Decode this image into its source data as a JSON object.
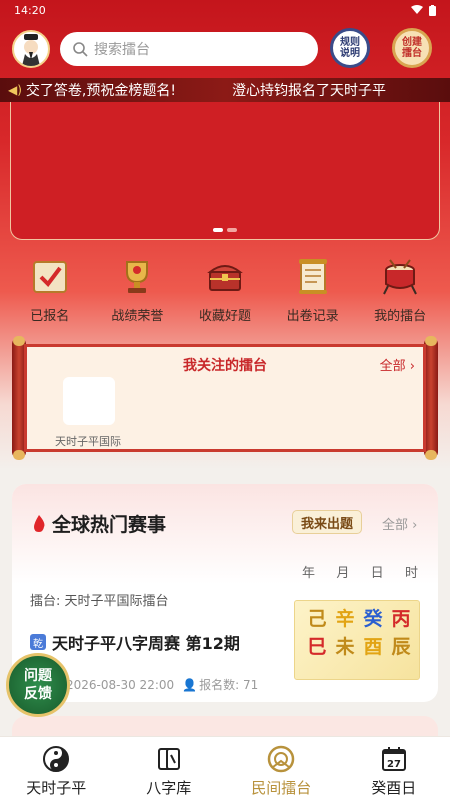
{
  "status_bar": {
    "time": "14:20"
  },
  "header": {
    "search_placeholder": "搜索擂台",
    "rules_button": [
      "规则",
      "说明"
    ],
    "create_button": [
      "创建",
      "擂台"
    ]
  },
  "marquee": {
    "messages": [
      "交了答卷,预祝金榜题名!",
      "澄心持钧报名了天时子平"
    ]
  },
  "quick_actions": [
    {
      "label": "已报名",
      "icon": "signed-up-icon"
    },
    {
      "label": "战绩荣誉",
      "icon": "trophy-icon"
    },
    {
      "label": "收藏好题",
      "icon": "treasure-chest-icon"
    },
    {
      "label": "出卷记录",
      "icon": "scroll-record-icon"
    },
    {
      "label": "我的擂台",
      "icon": "drum-icon"
    }
  ],
  "followed": {
    "title": "我关注的擂台",
    "all_label": "全部",
    "arenas": [
      {
        "name": "天时子平国际"
      }
    ]
  },
  "events": {
    "title": "全球热门赛事",
    "post_button": "我来出题",
    "all_label": "全部",
    "columns": [
      "年",
      "月",
      "日",
      "时"
    ],
    "item": {
      "arena": "擂台: 天时子平国际擂台",
      "badge": "乾",
      "name": "天时子平八字周赛 第12期",
      "datetime": "2026-08-30 22:00",
      "signup": "报名数: 71",
      "bazi": {
        "stems": [
          "己",
          "辛",
          "癸",
          "丙"
        ],
        "branches": [
          "巳",
          "未",
          "酉",
          "辰"
        ]
      }
    }
  },
  "feedback_button": [
    "问题",
    "反馈"
  ],
  "tabbar": [
    {
      "label": "天时子平",
      "icon": "yin-yang-icon",
      "active": false
    },
    {
      "label": "八字库",
      "icon": "cards-icon",
      "active": false
    },
    {
      "label": "民间擂台",
      "icon": "arena-ring-icon",
      "active": true
    },
    {
      "label": "癸酉日",
      "icon": "calendar-icon",
      "active": false,
      "day": "27"
    }
  ],
  "colors": {
    "primary_red": "#c8282a",
    "gold": "#b8923c",
    "wood": "#2f8d4c",
    "fire": "#d42a2a",
    "water": "#2b5fd0",
    "metal": "#e2a414",
    "earth": "#c08a1a"
  }
}
